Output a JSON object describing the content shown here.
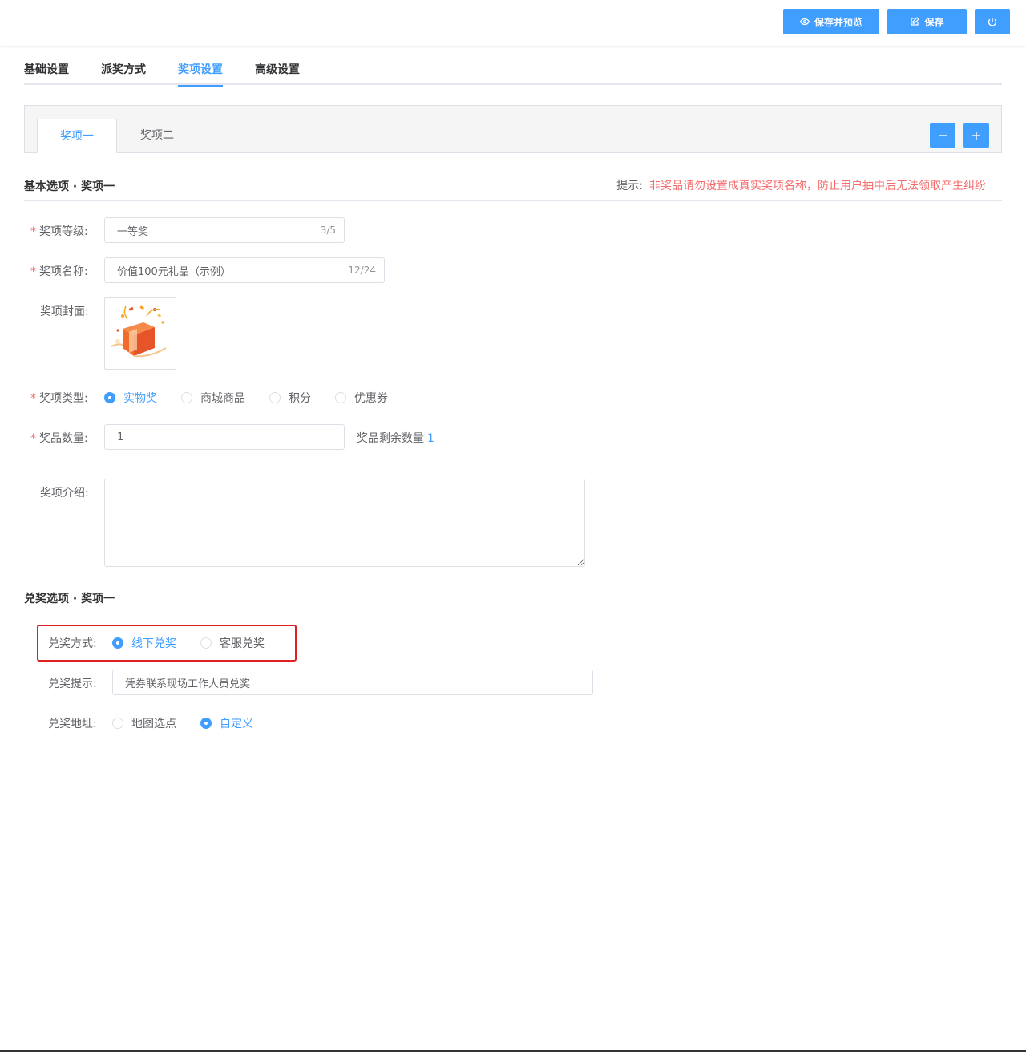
{
  "toolbar": {
    "preview_label": "保存并预览",
    "save_label": "保存",
    "accent": "#409eff"
  },
  "main_tabs": [
    {
      "label": "基础设置",
      "active": false
    },
    {
      "label": "派奖方式",
      "active": false
    },
    {
      "label": "奖项设置",
      "active": true
    },
    {
      "label": "高级设置",
      "active": false
    }
  ],
  "prize_tabs": [
    {
      "label": "奖项一",
      "active": true
    },
    {
      "label": "奖项二",
      "active": false
    }
  ],
  "basic": {
    "title": "基本选项 · 奖项一",
    "hint_label": "提示:",
    "hint_text": "非奖品请勿设置成真实奖项名称，防止用户抽中后无法领取产生纠纷",
    "level_label": "奖项等级:",
    "level_value": "一等奖",
    "level_counter": "3/5",
    "name_label": "奖项名称:",
    "name_value": "价值100元礼品（示例）",
    "name_counter": "12/24",
    "cover_label": "奖项封面:",
    "type_label": "奖项类型:",
    "type_options": [
      {
        "label": "实物奖",
        "checked": true
      },
      {
        "label": "商城商品",
        "checked": false
      },
      {
        "label": "积分",
        "checked": false
      },
      {
        "label": "优惠券",
        "checked": false
      }
    ],
    "qty_label": "奖品数量:",
    "qty_value": "1",
    "remain_label": "奖品剩余数量",
    "remain_value": "1",
    "intro_label": "奖项介绍:",
    "intro_value": ""
  },
  "redeem": {
    "title": "兑奖选项 · 奖项一",
    "method_label": "兑奖方式:",
    "method_options": [
      {
        "label": "线下兑奖",
        "checked": true
      },
      {
        "label": "客服兑奖",
        "checked": false
      }
    ],
    "tip_label": "兑奖提示:",
    "tip_value": "凭券联系现场工作人员兑奖",
    "address_label": "兑奖地址:",
    "address_options": [
      {
        "label": "地图选点",
        "checked": false
      },
      {
        "label": "自定义",
        "checked": true
      }
    ]
  }
}
